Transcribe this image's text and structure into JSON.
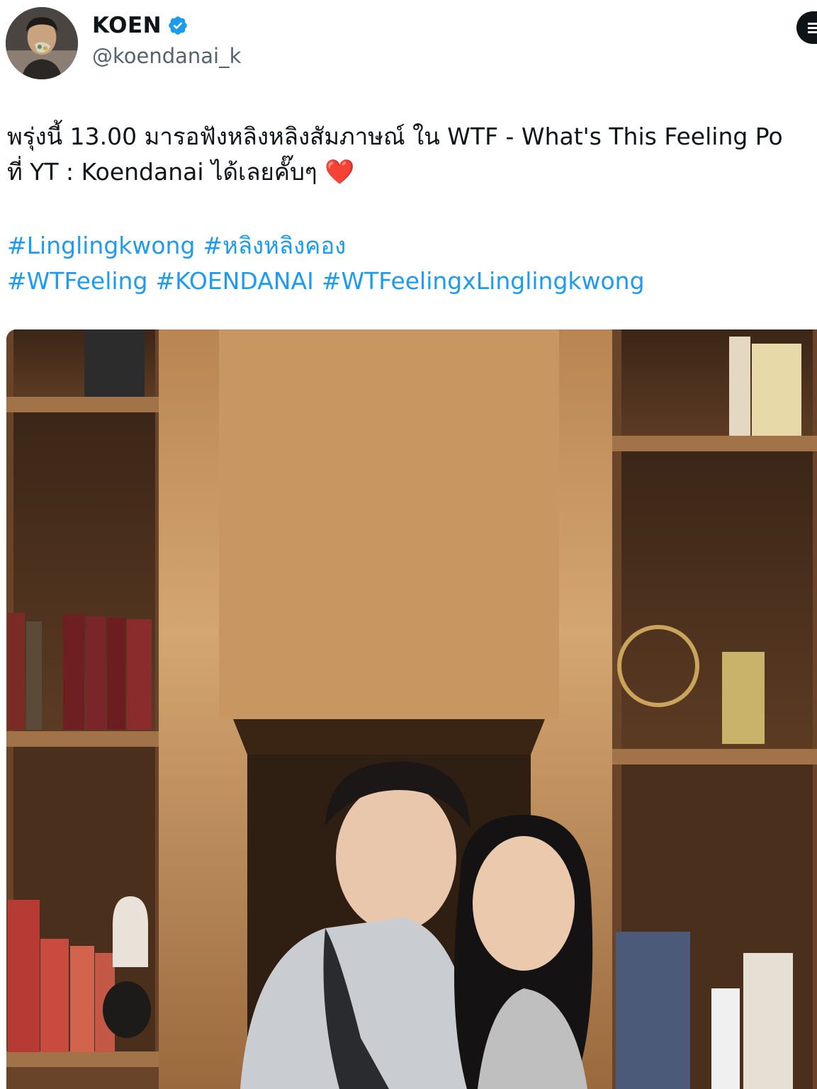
{
  "author": {
    "display_name": "KOEN",
    "handle": "@koendanai_k",
    "verified": true,
    "avatar_icon": "profile-photo"
  },
  "header": {
    "more_icon": "more-options-icon"
  },
  "tweet": {
    "line1": "พรุ่งนี้ 13.00 มารอฟังหลิงหลิงสัมภาษณ์ ใน WTF  - What's This Feeling Po",
    "line2_text": "ที่ YT : Koendanai ได้เลยคั๊บๆ",
    "line2_emoji": "❤️",
    "hashtag_lines": [
      [
        "#Linglingkwong",
        "#หลิงหลิงคอง"
      ],
      [
        "#WTFeeling",
        "#KOENDANAI",
        "#WTFeelingxLinglingkwong"
      ]
    ]
  },
  "media": {
    "alt": "Photo of two people smiling in front of wooden bookshelves"
  },
  "colors": {
    "link": "#1d9bf0",
    "secondary_text": "#536471",
    "verified": "#1d9bf0",
    "primary_text": "#0f1419"
  }
}
